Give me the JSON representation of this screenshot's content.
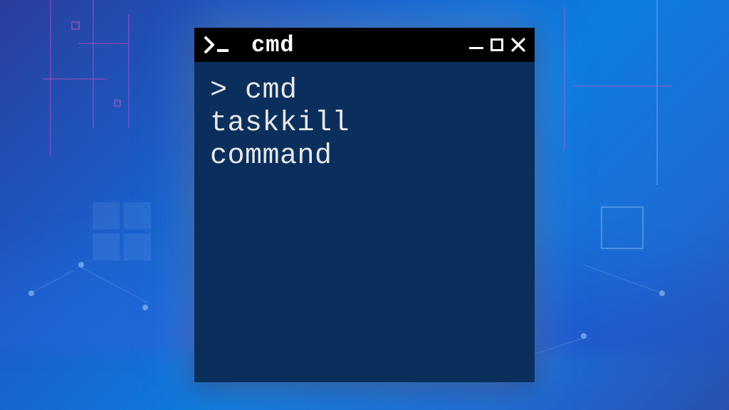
{
  "window": {
    "title": "cmd",
    "prompt_icon": ">_"
  },
  "terminal": {
    "prompt": ">",
    "line1": "cmd",
    "line2": "taskkill",
    "line3": "command"
  },
  "colors": {
    "titlebar_bg": "#000000",
    "terminal_bg": "#0a2f5c",
    "text": "#e8e8e8"
  }
}
